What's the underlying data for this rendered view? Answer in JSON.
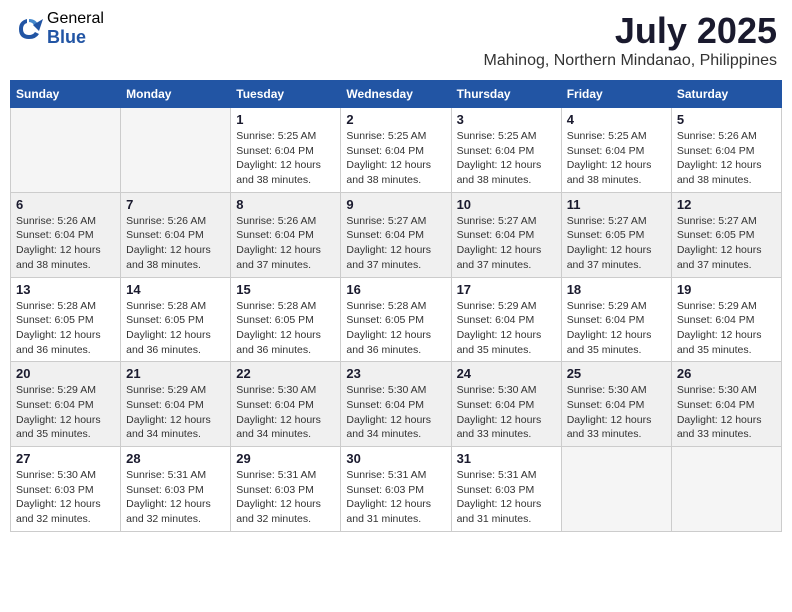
{
  "header": {
    "logo_general": "General",
    "logo_blue": "Blue",
    "title": "July 2025",
    "location": "Mahinog, Northern Mindanao, Philippines"
  },
  "weekdays": [
    "Sunday",
    "Monday",
    "Tuesday",
    "Wednesday",
    "Thursday",
    "Friday",
    "Saturday"
  ],
  "weeks": [
    [
      {
        "day": "",
        "info": ""
      },
      {
        "day": "",
        "info": ""
      },
      {
        "day": "1",
        "info": "Sunrise: 5:25 AM\nSunset: 6:04 PM\nDaylight: 12 hours and 38 minutes."
      },
      {
        "day": "2",
        "info": "Sunrise: 5:25 AM\nSunset: 6:04 PM\nDaylight: 12 hours and 38 minutes."
      },
      {
        "day": "3",
        "info": "Sunrise: 5:25 AM\nSunset: 6:04 PM\nDaylight: 12 hours and 38 minutes."
      },
      {
        "day": "4",
        "info": "Sunrise: 5:25 AM\nSunset: 6:04 PM\nDaylight: 12 hours and 38 minutes."
      },
      {
        "day": "5",
        "info": "Sunrise: 5:26 AM\nSunset: 6:04 PM\nDaylight: 12 hours and 38 minutes."
      }
    ],
    [
      {
        "day": "6",
        "info": "Sunrise: 5:26 AM\nSunset: 6:04 PM\nDaylight: 12 hours and 38 minutes."
      },
      {
        "day": "7",
        "info": "Sunrise: 5:26 AM\nSunset: 6:04 PM\nDaylight: 12 hours and 38 minutes."
      },
      {
        "day": "8",
        "info": "Sunrise: 5:26 AM\nSunset: 6:04 PM\nDaylight: 12 hours and 37 minutes."
      },
      {
        "day": "9",
        "info": "Sunrise: 5:27 AM\nSunset: 6:04 PM\nDaylight: 12 hours and 37 minutes."
      },
      {
        "day": "10",
        "info": "Sunrise: 5:27 AM\nSunset: 6:04 PM\nDaylight: 12 hours and 37 minutes."
      },
      {
        "day": "11",
        "info": "Sunrise: 5:27 AM\nSunset: 6:05 PM\nDaylight: 12 hours and 37 minutes."
      },
      {
        "day": "12",
        "info": "Sunrise: 5:27 AM\nSunset: 6:05 PM\nDaylight: 12 hours and 37 minutes."
      }
    ],
    [
      {
        "day": "13",
        "info": "Sunrise: 5:28 AM\nSunset: 6:05 PM\nDaylight: 12 hours and 36 minutes."
      },
      {
        "day": "14",
        "info": "Sunrise: 5:28 AM\nSunset: 6:05 PM\nDaylight: 12 hours and 36 minutes."
      },
      {
        "day": "15",
        "info": "Sunrise: 5:28 AM\nSunset: 6:05 PM\nDaylight: 12 hours and 36 minutes."
      },
      {
        "day": "16",
        "info": "Sunrise: 5:28 AM\nSunset: 6:05 PM\nDaylight: 12 hours and 36 minutes."
      },
      {
        "day": "17",
        "info": "Sunrise: 5:29 AM\nSunset: 6:04 PM\nDaylight: 12 hours and 35 minutes."
      },
      {
        "day": "18",
        "info": "Sunrise: 5:29 AM\nSunset: 6:04 PM\nDaylight: 12 hours and 35 minutes."
      },
      {
        "day": "19",
        "info": "Sunrise: 5:29 AM\nSunset: 6:04 PM\nDaylight: 12 hours and 35 minutes."
      }
    ],
    [
      {
        "day": "20",
        "info": "Sunrise: 5:29 AM\nSunset: 6:04 PM\nDaylight: 12 hours and 35 minutes."
      },
      {
        "day": "21",
        "info": "Sunrise: 5:29 AM\nSunset: 6:04 PM\nDaylight: 12 hours and 34 minutes."
      },
      {
        "day": "22",
        "info": "Sunrise: 5:30 AM\nSunset: 6:04 PM\nDaylight: 12 hours and 34 minutes."
      },
      {
        "day": "23",
        "info": "Sunrise: 5:30 AM\nSunset: 6:04 PM\nDaylight: 12 hours and 34 minutes."
      },
      {
        "day": "24",
        "info": "Sunrise: 5:30 AM\nSunset: 6:04 PM\nDaylight: 12 hours and 33 minutes."
      },
      {
        "day": "25",
        "info": "Sunrise: 5:30 AM\nSunset: 6:04 PM\nDaylight: 12 hours and 33 minutes."
      },
      {
        "day": "26",
        "info": "Sunrise: 5:30 AM\nSunset: 6:04 PM\nDaylight: 12 hours and 33 minutes."
      }
    ],
    [
      {
        "day": "27",
        "info": "Sunrise: 5:30 AM\nSunset: 6:03 PM\nDaylight: 12 hours and 32 minutes."
      },
      {
        "day": "28",
        "info": "Sunrise: 5:31 AM\nSunset: 6:03 PM\nDaylight: 12 hours and 32 minutes."
      },
      {
        "day": "29",
        "info": "Sunrise: 5:31 AM\nSunset: 6:03 PM\nDaylight: 12 hours and 32 minutes."
      },
      {
        "day": "30",
        "info": "Sunrise: 5:31 AM\nSunset: 6:03 PM\nDaylight: 12 hours and 31 minutes."
      },
      {
        "day": "31",
        "info": "Sunrise: 5:31 AM\nSunset: 6:03 PM\nDaylight: 12 hours and 31 minutes."
      },
      {
        "day": "",
        "info": ""
      },
      {
        "day": "",
        "info": ""
      }
    ]
  ]
}
